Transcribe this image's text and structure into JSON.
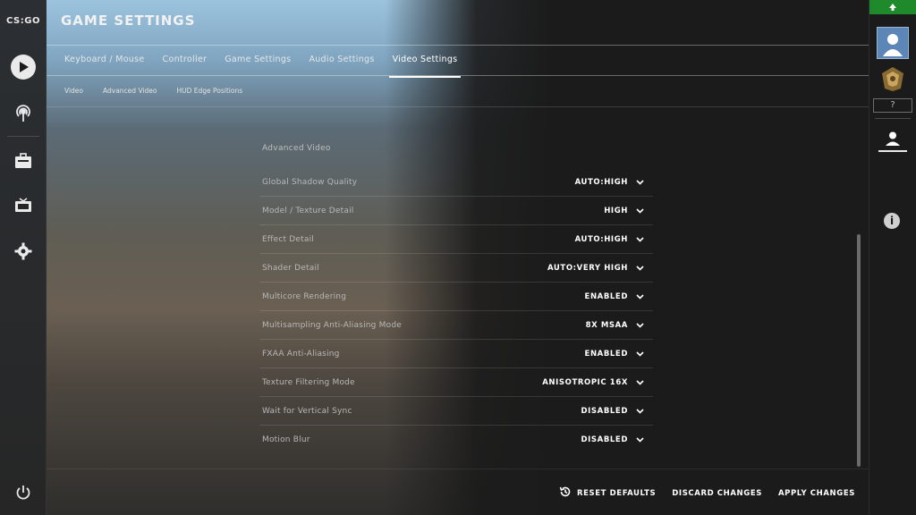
{
  "app": {
    "logo_text": "CS:GO",
    "page_title": "GAME SETTINGS"
  },
  "tabs": [
    "Keyboard / Mouse",
    "Controller",
    "Game Settings",
    "Audio Settings",
    "Video Settings"
  ],
  "active_tab": "Video Settings",
  "subtabs": [
    "Video",
    "Advanced Video",
    "HUD Edge Positions"
  ],
  "section_title": "Advanced Video",
  "settings": [
    {
      "label": "Global Shadow Quality",
      "value": "AUTO:HIGH"
    },
    {
      "label": "Model / Texture Detail",
      "value": "HIGH"
    },
    {
      "label": "Effect Detail",
      "value": "AUTO:HIGH"
    },
    {
      "label": "Shader Detail",
      "value": "AUTO:VERY HIGH"
    },
    {
      "label": "Multicore Rendering",
      "value": "ENABLED"
    },
    {
      "label": "Multisampling Anti-Aliasing Mode",
      "value": "8X MSAA"
    },
    {
      "label": "FXAA Anti-Aliasing",
      "value": "ENABLED"
    },
    {
      "label": "Texture Filtering Mode",
      "value": "ANISOTROPIC 16X"
    },
    {
      "label": "Wait for Vertical Sync",
      "value": "DISABLED"
    },
    {
      "label": "Motion Blur",
      "value": "DISABLED"
    }
  ],
  "footer": {
    "reset": "RESET DEFAULTS",
    "discard": "DISCARD CHANGES",
    "apply": "APPLY CHANGES"
  },
  "right_panel": {
    "help_badge": "?"
  },
  "colors": {
    "accent_green": "#1f8a2c",
    "avatar_blue": "#5b86b5"
  },
  "icons": {
    "play": "play-icon",
    "broadcast": "broadcast-icon",
    "inventory": "briefcase-icon",
    "watch": "tv-icon",
    "settings": "gear-icon",
    "power": "power-icon",
    "reset": "reset-history-icon",
    "upgrade": "arrow-up-icon",
    "friends": "person-icon",
    "info": "info-icon",
    "dropdown": "chevron-down-icon"
  }
}
